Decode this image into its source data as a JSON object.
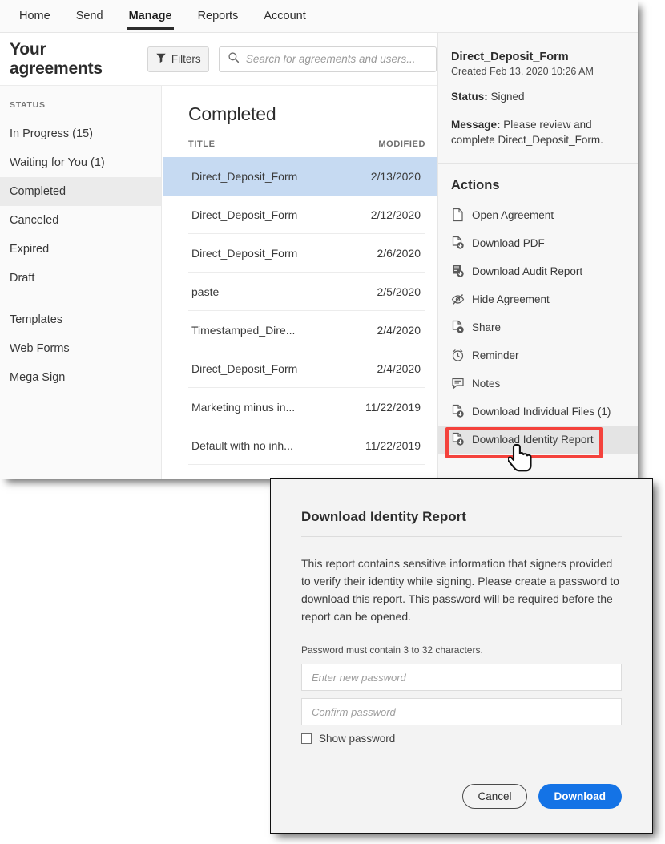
{
  "topnav": {
    "tabs": [
      {
        "label": "Home",
        "active": false
      },
      {
        "label": "Send",
        "active": false
      },
      {
        "label": "Manage",
        "active": true
      },
      {
        "label": "Reports",
        "active": false
      },
      {
        "label": "Account",
        "active": false
      }
    ]
  },
  "header": {
    "page_title": "Your agreements",
    "filters_label": "Filters",
    "search_placeholder": "Search for agreements and users..."
  },
  "sidebar": {
    "section_label": "STATUS",
    "status_items": [
      {
        "label": "In Progress (15)",
        "selected": false
      },
      {
        "label": "Waiting for You (1)",
        "selected": false
      },
      {
        "label": "Completed",
        "selected": true
      },
      {
        "label": "Canceled",
        "selected": false
      },
      {
        "label": "Expired",
        "selected": false
      },
      {
        "label": "Draft",
        "selected": false
      }
    ],
    "other_items": [
      {
        "label": "Templates"
      },
      {
        "label": "Web Forms"
      },
      {
        "label": "Mega Sign"
      }
    ]
  },
  "list": {
    "title": "Completed",
    "columns": {
      "title": "TITLE",
      "modified": "MODIFIED"
    },
    "rows": [
      {
        "title": "Direct_Deposit_Form",
        "modified": "2/13/2020",
        "selected": true
      },
      {
        "title": "Direct_Deposit_Form",
        "modified": "2/12/2020",
        "selected": false
      },
      {
        "title": "Direct_Deposit_Form",
        "modified": "2/6/2020",
        "selected": false
      },
      {
        "title": "paste",
        "modified": "2/5/2020",
        "selected": false
      },
      {
        "title": "Timestamped_Dire...",
        "modified": "2/4/2020",
        "selected": false
      },
      {
        "title": "Direct_Deposit_Form",
        "modified": "2/4/2020",
        "selected": false
      },
      {
        "title": "Marketing minus in...",
        "modified": "11/22/2019",
        "selected": false
      },
      {
        "title": "Default with no inh...",
        "modified": "11/22/2019",
        "selected": false
      }
    ]
  },
  "detail": {
    "title": "Direct_Deposit_Form",
    "created": "Created Feb 13, 2020 10:26 AM",
    "status_label": "Status:",
    "status_value": "Signed",
    "message_label": "Message:",
    "message_value": "Please review and complete Direct_Deposit_Form.",
    "actions_heading": "Actions",
    "actions": [
      {
        "label": "Open Agreement",
        "icon": "document-icon",
        "highlighted": false
      },
      {
        "label": "Download PDF",
        "icon": "pdf-download-icon",
        "highlighted": false
      },
      {
        "label": "Download Audit Report",
        "icon": "audit-report-download-icon",
        "highlighted": false
      },
      {
        "label": "Hide Agreement",
        "icon": "eye-slash-icon",
        "highlighted": false
      },
      {
        "label": "Share",
        "icon": "share-document-icon",
        "highlighted": false
      },
      {
        "label": "Reminder",
        "icon": "alarm-clock-icon",
        "highlighted": false
      },
      {
        "label": "Notes",
        "icon": "note-bubble-icon",
        "highlighted": false
      },
      {
        "label": "Download Individual Files (1)",
        "icon": "file-download-icon",
        "highlighted": false
      },
      {
        "label": "Download Identity Report",
        "icon": "file-download-icon",
        "highlighted": true
      }
    ]
  },
  "annotation": {
    "highlight_color": "#f4423c",
    "cursor": "pointing-hand-cursor"
  },
  "modal": {
    "title": "Download Identity Report",
    "body": "This report contains sensitive information that signers provided to verify their identity while signing. Please create a password to download this report. This password will be required before the report can be opened.",
    "hint": "Password must contain 3 to 32 characters.",
    "new_password_placeholder": "Enter new password",
    "confirm_password_placeholder": "Confirm password",
    "new_password_value": "",
    "confirm_password_value": "",
    "show_password_label": "Show password",
    "show_password_checked": false,
    "cancel_label": "Cancel",
    "download_label": "Download",
    "download_color": "#1473e6"
  }
}
